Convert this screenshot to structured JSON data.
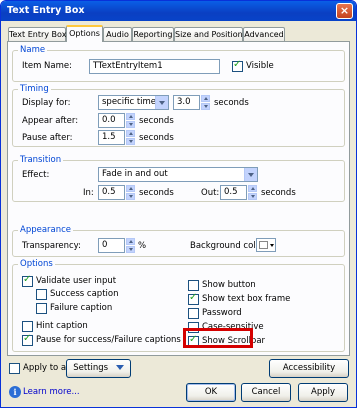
{
  "window": {
    "title": "Text Entry Box",
    "close_glyph": "×"
  },
  "tabs": [
    "Text Entry Box",
    "Options",
    "Audio",
    "Reporting",
    "Size and Position",
    "Advanced"
  ],
  "name_group": {
    "legend": "Name",
    "item_name_label": "Item Name:",
    "item_name_value": "TTextEntryItem1",
    "visible_label": "Visible",
    "visible_checked": true
  },
  "timing": {
    "legend": "Timing",
    "display_for_label": "Display for:",
    "display_for_value": "specific time",
    "display_seconds_value": "3.0",
    "display_seconds_unit": "seconds",
    "appear_after_label": "Appear after:",
    "appear_after_value": "0.0",
    "appear_after_unit": "seconds",
    "pause_after_label": "Pause after:",
    "pause_after_value": "1.5",
    "pause_after_unit": "seconds"
  },
  "transition": {
    "legend": "Transition",
    "effect_label": "Effect:",
    "effect_value": "Fade in and out",
    "in_label": "In:",
    "in_value": "0.5",
    "in_unit": "seconds",
    "out_label": "Out:",
    "out_value": "0.5",
    "out_unit": "seconds"
  },
  "appearance": {
    "legend": "Appearance",
    "transparency_label": "Transparency:",
    "transparency_value": "0",
    "transparency_unit": "%",
    "background_color_label": "Background color:",
    "background_color": "#FFFFFF"
  },
  "options": {
    "legend": "Options",
    "left": [
      {
        "label": "Validate user input",
        "checked": true
      },
      {
        "label": "Success caption",
        "checked": false
      },
      {
        "label": "Failure caption",
        "checked": false
      },
      {
        "label": "Hint caption",
        "checked": false
      },
      {
        "label": "Pause for success/Failure captions",
        "checked": true
      }
    ],
    "right": [
      {
        "label": "Show button",
        "checked": false
      },
      {
        "label": "Show text box frame",
        "checked": true
      },
      {
        "label": "Password",
        "checked": false
      },
      {
        "label": "Case-sensitive",
        "checked": false
      },
      {
        "label": "Show Scrollbar",
        "checked": true
      }
    ]
  },
  "bottom": {
    "apply_to_all_label": "Apply to all",
    "apply_to_all_checked": false,
    "settings_label": "Settings",
    "accessibility_label": "Accessibility",
    "learn_more_label": "Learn more...",
    "ok_label": "OK",
    "cancel_label": "Cancel",
    "apply_label": "Apply"
  },
  "colors": {
    "title_bar": "#0A3FC2",
    "group_legend": "#0046D5",
    "highlight_box": "#D40000",
    "dialog_face": "#ECE9D8"
  }
}
